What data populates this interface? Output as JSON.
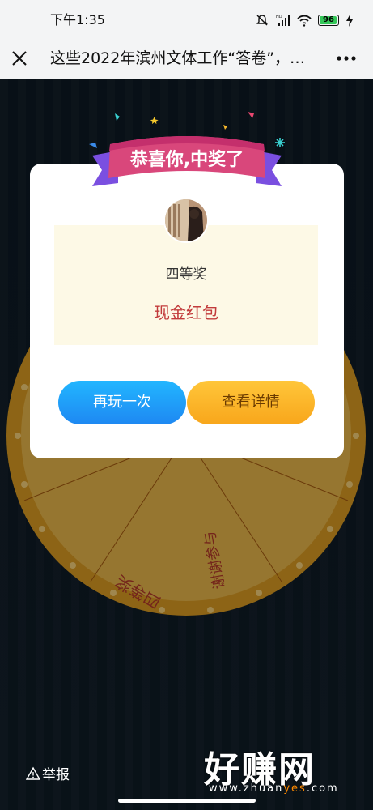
{
  "status_bar": {
    "time": "下午1:35",
    "battery_level": "96",
    "battery_fraction": 0.96
  },
  "header": {
    "title": "这些2022年滨州文体工作“答卷”，…"
  },
  "modal": {
    "banner_text": "恭喜你,中奖了",
    "prize_level": "四等奖",
    "prize_name": "现金红包",
    "replay_button": "再玩一次",
    "detail_button": "查看详情"
  },
  "wheel": {
    "segments": [
      "四等奖",
      "谢谢参与"
    ]
  },
  "footer": {
    "report_label": "举报"
  },
  "watermark": {
    "title": "好赚网",
    "url_prefix": "www.zhuan",
    "url_highlight": "yes",
    "url_suffix": ".com"
  },
  "colors": {
    "replay_button": "#1e88f2",
    "detail_button": "#f8a61b",
    "prize_text": "#c23b3b",
    "banner": "#d9477b"
  }
}
